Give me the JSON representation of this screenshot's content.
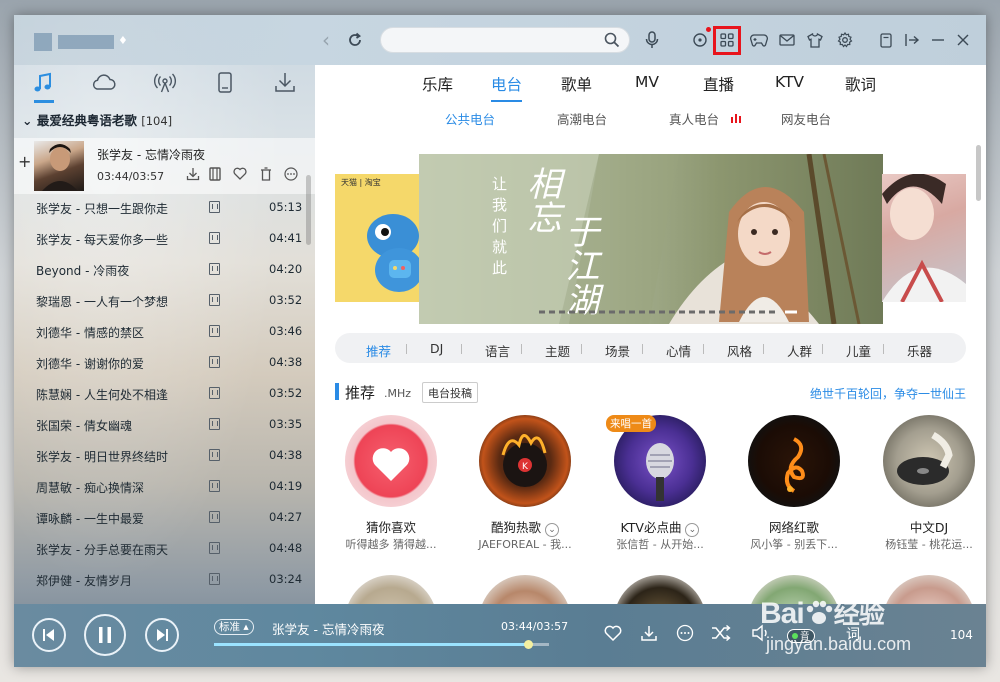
{
  "titlebar": {
    "search_placeholder": "",
    "icons": [
      "back-icon",
      "refresh-icon",
      "search-icon",
      "microphone-icon",
      "radio-dot-icon",
      "apps-grid-icon",
      "gamepad-icon",
      "mail-icon",
      "skin-tshirt-icon",
      "settings-gear-icon",
      "mini-mode-icon",
      "exit-to-tray-icon",
      "minimize-icon",
      "close-icon"
    ]
  },
  "left_tabs": [
    "music-note-icon",
    "cloud-icon",
    "broadcast-icon",
    "device-icon",
    "download-icon"
  ],
  "playlist": {
    "name": "最爱经典粤语老歌",
    "count": "[104]"
  },
  "now_playing_item": {
    "title": "张学友 - 忘情冷雨夜",
    "time": "03:44/03:57"
  },
  "songs": [
    {
      "name": "张学友 - 只想一生跟你走",
      "duration": "05:13"
    },
    {
      "name": "张学友 - 每天爱你多一些",
      "duration": "04:41"
    },
    {
      "name": "Beyond - 冷雨夜",
      "duration": "04:20"
    },
    {
      "name": "黎瑞恩 - 一人有一个梦想",
      "duration": "03:52"
    },
    {
      "name": "刘德华 - 情感的禁区",
      "duration": "03:46"
    },
    {
      "name": "刘德华 - 谢谢你的爱",
      "duration": "04:38"
    },
    {
      "name": "陈慧娴 - 人生何处不相逢",
      "duration": "03:52"
    },
    {
      "name": "张国荣 - 倩女幽魂",
      "duration": "03:35"
    },
    {
      "name": "张学友 - 明日世界终结时",
      "duration": "04:38"
    },
    {
      "name": "周慧敏 - 痴心换情深",
      "duration": "04:19"
    },
    {
      "name": "谭咏麟 - 一生中最爱",
      "duration": "04:27"
    },
    {
      "name": "张学友 - 分手总要在雨天",
      "duration": "04:48"
    },
    {
      "name": "郑伊健 - 友情岁月",
      "duration": "03:24"
    }
  ],
  "main_tabs": [
    "乐库",
    "电台",
    "歌单",
    "MV",
    "直播",
    "KTV",
    "歌词"
  ],
  "main_tab_active": "电台",
  "sub_tabs": [
    "公共电台",
    "高潮电台",
    "真人电台",
    "网友电台"
  ],
  "banner": {
    "left_tag": "天猫 | 淘宝",
    "poem_small": [
      "让",
      "我",
      "们",
      "就",
      "此"
    ],
    "poem_large_1": "相忘",
    "poem_large_2": "于江湖",
    "poem_large_3": "于"
  },
  "categories": [
    "推荐",
    "DJ",
    "语言",
    "主题",
    "场景",
    "心情",
    "风格",
    "人群",
    "儿童",
    "乐器"
  ],
  "recommend": {
    "title": "推荐",
    "mhz": ".MHz",
    "contribute": "电台投稿",
    "link": "绝世千百轮回，争夺一世仙王"
  },
  "radios": [
    {
      "name": "猜你喜欢",
      "sub": "听得越多 猜得越...",
      "badge": ""
    },
    {
      "name": "酷狗热歌",
      "sub": "JAEFOREAL - 我...",
      "badge": ""
    },
    {
      "name": "KTV必点曲",
      "sub": "张信哲 - 从开始...",
      "badge": "来唱一首"
    },
    {
      "name": "网络红歌",
      "sub": "风小筝 - 别丢下...",
      "badge": ""
    },
    {
      "name": "中文DJ",
      "sub": "杨钰莹 - 桃花运...",
      "badge": ""
    }
  ],
  "player": {
    "mode": "标准",
    "title": "张学友 - 忘情冷雨夜",
    "time": "03:44/03:57",
    "progress": 0.937,
    "quality": "音",
    "lyric": "词",
    "count": "104"
  },
  "watermark": {
    "brand": "Bai",
    "brand_suffix": "经验",
    "url": "jingyan.baidu.com"
  },
  "colors": {
    "accent": "#2a8be5",
    "highlight_box": "#e8141c",
    "badge": "#ee8a17"
  }
}
